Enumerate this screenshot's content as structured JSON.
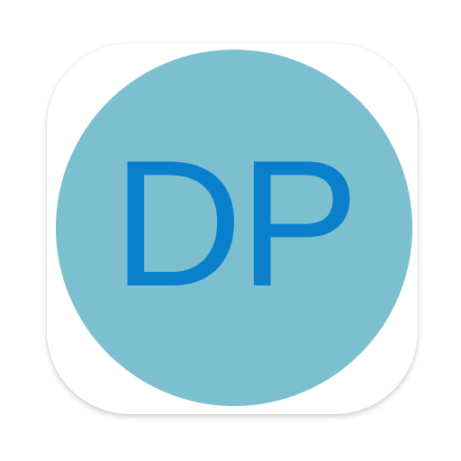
{
  "icon": {
    "monogram": "DP"
  },
  "colors": {
    "tile_background": "#ffffff",
    "circle_fill": "#7cc0d0",
    "monogram_text": "#0a80cc"
  }
}
